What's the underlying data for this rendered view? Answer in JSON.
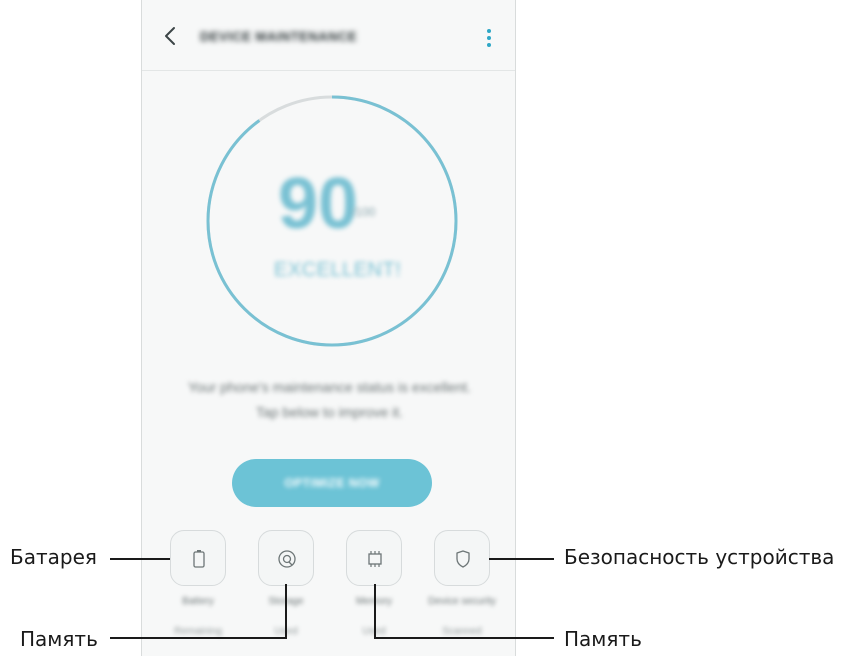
{
  "app": {
    "title": "DEVICE MAINTENANCE",
    "back_icon": "back-arrow-icon",
    "menu_icon": "more-vertical-icon"
  },
  "score": {
    "value": "90",
    "unit": "/100",
    "status": "EXCELLENT!",
    "progress": 0.9,
    "ring_color": "#79c1d3",
    "ring_track_color": "#d8dcdd"
  },
  "message": {
    "line1": "Your phone's maintenance status is excellent.",
    "line2": "Tap below to improve it."
  },
  "optimize_button": {
    "label": "OPTIMIZE NOW",
    "color": "#6cc3d6"
  },
  "tiles": [
    {
      "icon": "battery-icon",
      "label": "Battery",
      "sub": "Remaining"
    },
    {
      "icon": "storage-icon",
      "label": "Storage",
      "sub": "Used"
    },
    {
      "icon": "memory-chip-icon",
      "label": "Memory",
      "sub": "Used"
    },
    {
      "icon": "shield-icon",
      "label": "Device security",
      "sub": "Scanned"
    }
  ],
  "callouts": {
    "battery": "Батарея",
    "storage": "Память",
    "memory": "Память",
    "security": "Безопасность устройства"
  }
}
